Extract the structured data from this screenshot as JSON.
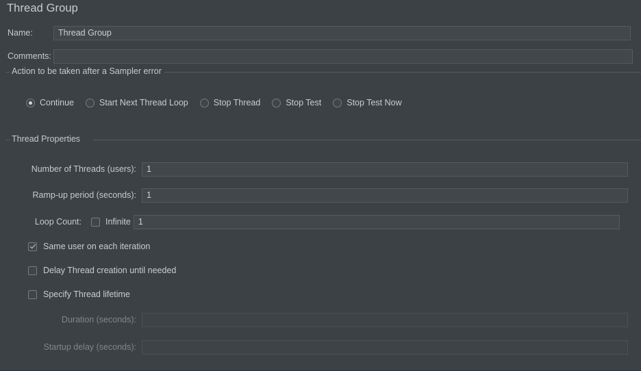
{
  "panel": {
    "title": "Thread Group"
  },
  "name_row": {
    "label": "Name:",
    "value": "Thread Group"
  },
  "comments_row": {
    "label": "Comments:",
    "value": ""
  },
  "sampler_error": {
    "caption": "Action to be taken after a Sampler error",
    "options": [
      {
        "label": "Continue",
        "selected": true
      },
      {
        "label": "Start Next Thread Loop",
        "selected": false
      },
      {
        "label": "Stop Thread",
        "selected": false
      },
      {
        "label": "Stop Test",
        "selected": false
      },
      {
        "label": "Stop Test Now",
        "selected": false
      }
    ]
  },
  "thread_properties": {
    "caption": "Thread Properties",
    "threads": {
      "label": "Number of Threads (users):",
      "value": "1"
    },
    "rampup": {
      "label": "Ramp-up period (seconds):",
      "value": "1"
    },
    "loop": {
      "label": "Loop Count:",
      "infinite_label": "Infinite",
      "infinite_checked": false,
      "value": "1"
    },
    "checkboxes": [
      {
        "label": "Same user on each iteration",
        "checked": true
      },
      {
        "label": "Delay Thread creation until needed",
        "checked": false
      },
      {
        "label": "Specify Thread lifetime",
        "checked": false
      }
    ],
    "duration": {
      "label": "Duration (seconds):",
      "value": "",
      "enabled": false
    },
    "startup_delay": {
      "label": "Startup delay (seconds):",
      "value": "",
      "enabled": false
    }
  },
  "colors": {
    "background": "#3b4144",
    "field_background": "#41474a",
    "field_border": "#555b5d",
    "text": "#c9cdce",
    "text_disabled": "#80878a",
    "group_line": "#565c5e"
  }
}
